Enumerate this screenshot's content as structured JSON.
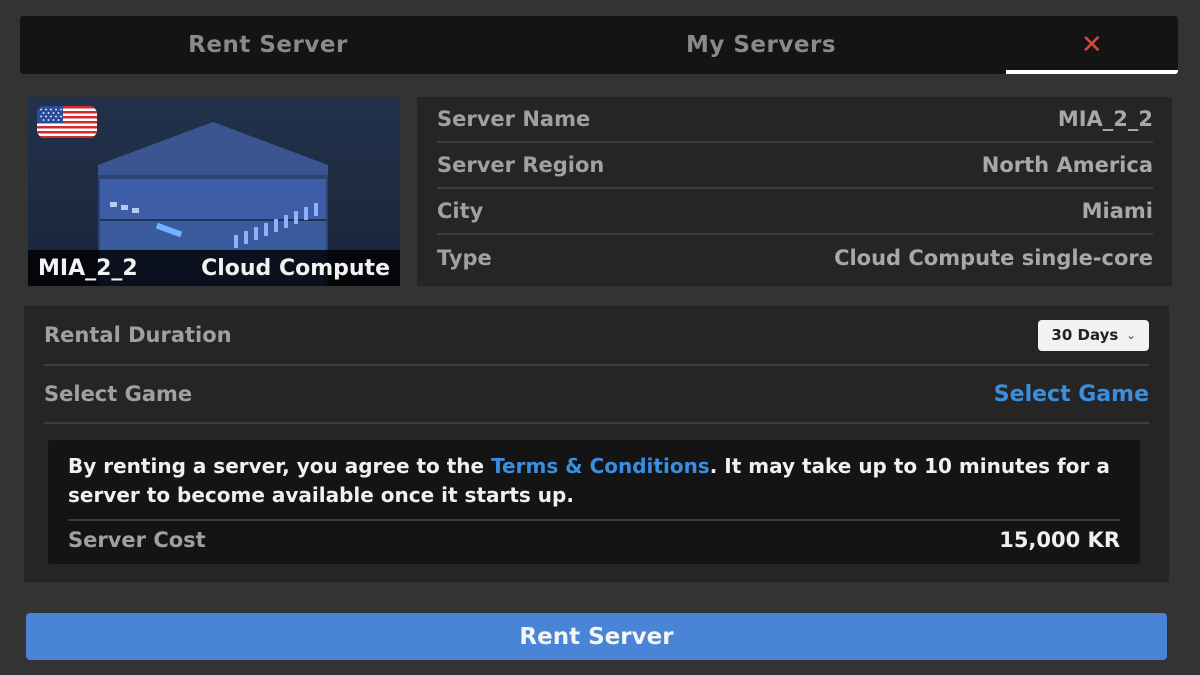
{
  "tabs": {
    "rent_label": "Rent Server",
    "my_servers_label": "My Servers",
    "close_label": "✕"
  },
  "server_card": {
    "flag": "us-flag-icon",
    "name": "MIA_2_2",
    "type_short": "Cloud Compute"
  },
  "info": [
    {
      "key": "Server Name",
      "value": "MIA_2_2"
    },
    {
      "key": "Server Region",
      "value": "North America"
    },
    {
      "key": "City",
      "value": "Miami"
    },
    {
      "key": "Type",
      "value": "Cloud Compute single-core"
    }
  ],
  "rental": {
    "duration_label": "Rental Duration",
    "duration_value": "30 Days",
    "game_label": "Select Game",
    "game_link": "Select Game"
  },
  "notice": {
    "text_before": "By renting a server, you agree to the ",
    "link": "Terms & Conditions",
    "text_after": ". It may take up to 10 minutes for a server to become available once it starts up.",
    "cost_label": "Server Cost",
    "cost_value": "15,000 KR"
  },
  "rent_button": "Rent Server",
  "colors": {
    "background": "#333333",
    "accent_blue": "#3a8ee0",
    "button_blue": "#4a84d6",
    "close_red": "#e0453d"
  }
}
